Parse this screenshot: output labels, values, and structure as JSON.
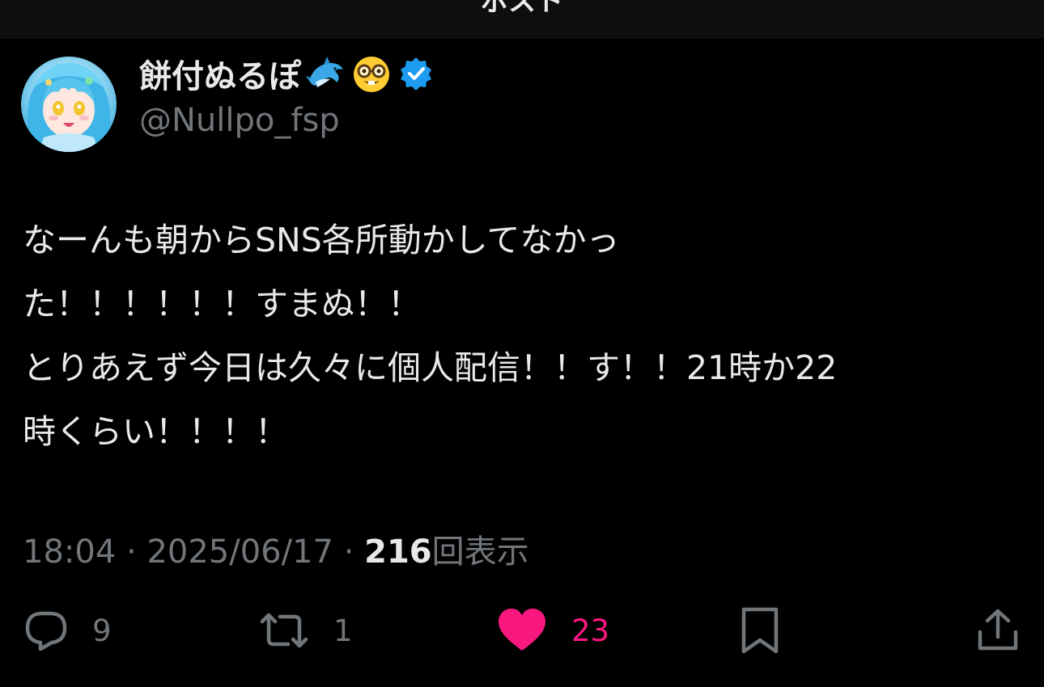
{
  "header": {
    "title": "ポスト"
  },
  "author": {
    "display_name": "餅付ぬるぽ",
    "emojis": [
      "dolphin-emoji",
      "nerd-face-emoji"
    ],
    "verified": true,
    "handle": "@Nullpo_fsp"
  },
  "tweet": {
    "lines": [
      "なーんも朝からSNS各所動かしてなかっ",
      "た！！！！！！すまぬ！！",
      "とりあえず今日は久々に個人配信！！す！！21時か22",
      "時くらい！！！！"
    ]
  },
  "meta": {
    "time": "18:04",
    "separator1": " · ",
    "date": "2025/06/17",
    "separator2": " · ",
    "views_count": "216",
    "views_label": "回表示"
  },
  "actions": {
    "reply": {
      "icon": "reply-icon",
      "count": "9"
    },
    "repost": {
      "icon": "repost-icon",
      "count": "1"
    },
    "like": {
      "icon": "heart-icon",
      "count": "23",
      "liked": true
    },
    "bookmark": {
      "icon": "bookmark-icon"
    },
    "share": {
      "icon": "share-icon"
    }
  },
  "colors": {
    "background": "#000000",
    "text": "#e7e9ea",
    "secondary_text": "#71767b",
    "like": "#f91880",
    "verified": "#1d9bf0"
  }
}
